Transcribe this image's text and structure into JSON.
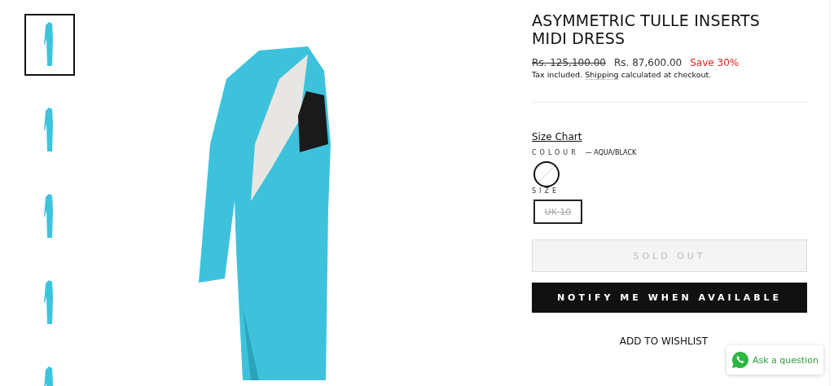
{
  "thumbnails": [
    {
      "selected": true
    },
    {
      "selected": false
    },
    {
      "selected": false
    },
    {
      "selected": false
    },
    {
      "selected": false
    }
  ],
  "product": {
    "title": "ASYMMETRIC TULLE INSERTS MIDI DRESS",
    "compare_price": "Rs. 125,100.00",
    "price": "Rs. 87,600.00",
    "savings": "Save 30%",
    "tax_note": {
      "before": "Tax included. ",
      "link": "Shipping",
      "after": " calculated at checkout."
    },
    "size_chart": "Size Chart",
    "colour": {
      "label": "COLOUR",
      "value": "— AQUA/BLACK",
      "swatches": [
        {
          "color": "#ffffff",
          "selected": true,
          "available": false
        }
      ]
    },
    "size": {
      "label": "SIZE",
      "options": [
        {
          "label": "UK 10",
          "selected": true,
          "available": false
        }
      ]
    },
    "sold_out_button": "SOLD OUT",
    "notify_button": "NOTIFY ME WHEN AVAILABLE",
    "wishlist": "ADD TO WISHLIST"
  },
  "chat_button": "Ask a question"
}
